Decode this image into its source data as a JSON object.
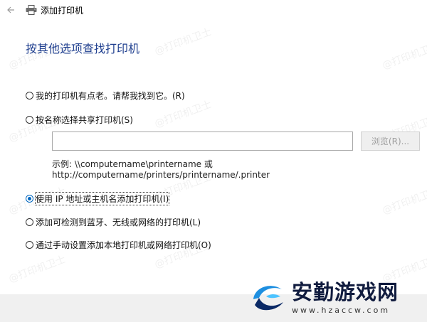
{
  "window": {
    "title": "添加打印机",
    "back_icon": "back-arrow-icon",
    "printer_icon": "printer-icon"
  },
  "heading": "按其他选项查找打印机",
  "options": [
    {
      "label": "我的打印机有点老。请帮我找到它。(R)",
      "selected": false
    },
    {
      "label": "按名称选择共享打印机(S)",
      "selected": false
    },
    {
      "label": "使用 IP 地址或主机名添加打印机(I)",
      "selected": true
    },
    {
      "label": "添加可检测到蓝牙、无线或网络的打印机(L)",
      "selected": false
    },
    {
      "label": "通过手动设置添加本地打印机或网络打印机(O)",
      "selected": false
    }
  ],
  "share": {
    "value": "",
    "browse_label": "浏览(R)...",
    "example_line1": "示例: \\\\computername\\printername 或",
    "example_line2": "http://computername/printers/printername/.printer"
  },
  "watermark": "@打印机卫士",
  "brand": {
    "name": "安勤游戏网",
    "url": "www.hzaccw.com"
  },
  "colors": {
    "heading": "#1f3f8f",
    "accent": "#0067c0",
    "footer": "#f0f0f0"
  }
}
